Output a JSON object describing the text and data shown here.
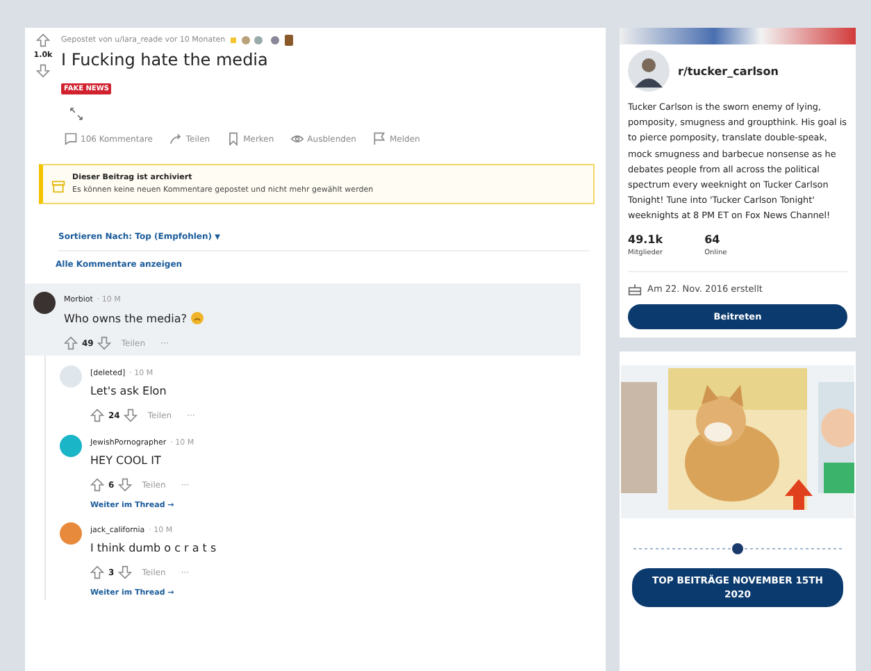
{
  "post": {
    "meta": "Gepostet von u/lara_reade vor 10 Monaten",
    "score": "1.0k",
    "title": "I Fucking hate the media",
    "flair": "FAKE NEWS",
    "actions": [
      {
        "kind": "comment",
        "label": "106 Kommentare"
      },
      {
        "kind": "share",
        "label": "Teilen"
      },
      {
        "kind": "save",
        "label": "Merken"
      },
      {
        "kind": "hide",
        "label": "Ausblenden"
      },
      {
        "kind": "report",
        "label": "Melden"
      }
    ]
  },
  "archived": {
    "title": "Dieser Beitrag ist archiviert",
    "text": "Es können keine neuen Kommentare gepostet und nicht mehr gewählt werden"
  },
  "sort": {
    "label": "Sortieren Nach: Top (Empfohlen)",
    "caret": "▼"
  },
  "all_comments": "Alle Kommentare anzeigen",
  "comments": [
    {
      "author": "Morbiot",
      "time": "· 10 M",
      "text": "Who owns the media?",
      "emoji": true,
      "score": "49",
      "share": "Teilen",
      "more": "···",
      "color": "#3a3230",
      "highlighted": true,
      "children": [
        {
          "author": "[deleted]",
          "time": "· 10 M",
          "text": "Let's ask Elon",
          "emoji": false,
          "score": "24",
          "share": "Teilen",
          "more": "···",
          "color": "#dfe6ec"
        },
        {
          "author": "JewishPornographer",
          "time": "· 10 M",
          "text": "HEY COOL IT",
          "emoji": false,
          "score": "6",
          "share": "Teilen",
          "more": "···",
          "color": "#1bb5c8",
          "continue": "Weiter im Thread →"
        },
        {
          "author": "jack_california",
          "time": "· 10 M",
          "text": "I think dumb o c r a t s",
          "emoji": false,
          "score": "3",
          "share": "Teilen",
          "more": "···",
          "color": "#e88a3c",
          "continue": "Weiter im Thread →"
        }
      ]
    }
  ],
  "community": {
    "name": "r/tucker_carlson",
    "description": "Tucker Carlson is the sworn enemy of lying, pomposity, smugness and groupthink. His goal is to pierce pomposity, translate double-speak, mock smugness and barbecue nonsense as he debates people from all across the political spectrum every weeknight on Tucker Carlson Tonight! Tune into 'Tucker Carlson Tonight' weeknights at 8 PM ET on Fox News Channel!",
    "stats": [
      {
        "value": "49.1k",
        "label": "Mitglieder"
      },
      {
        "value": "64",
        "label": "Online"
      }
    ],
    "created": "Am 22. Nov. 2016 erstellt",
    "join": "Beitreten"
  },
  "top_posts": {
    "button": "TOP BEITRÄGE NOVEMBER 15TH 2020"
  }
}
